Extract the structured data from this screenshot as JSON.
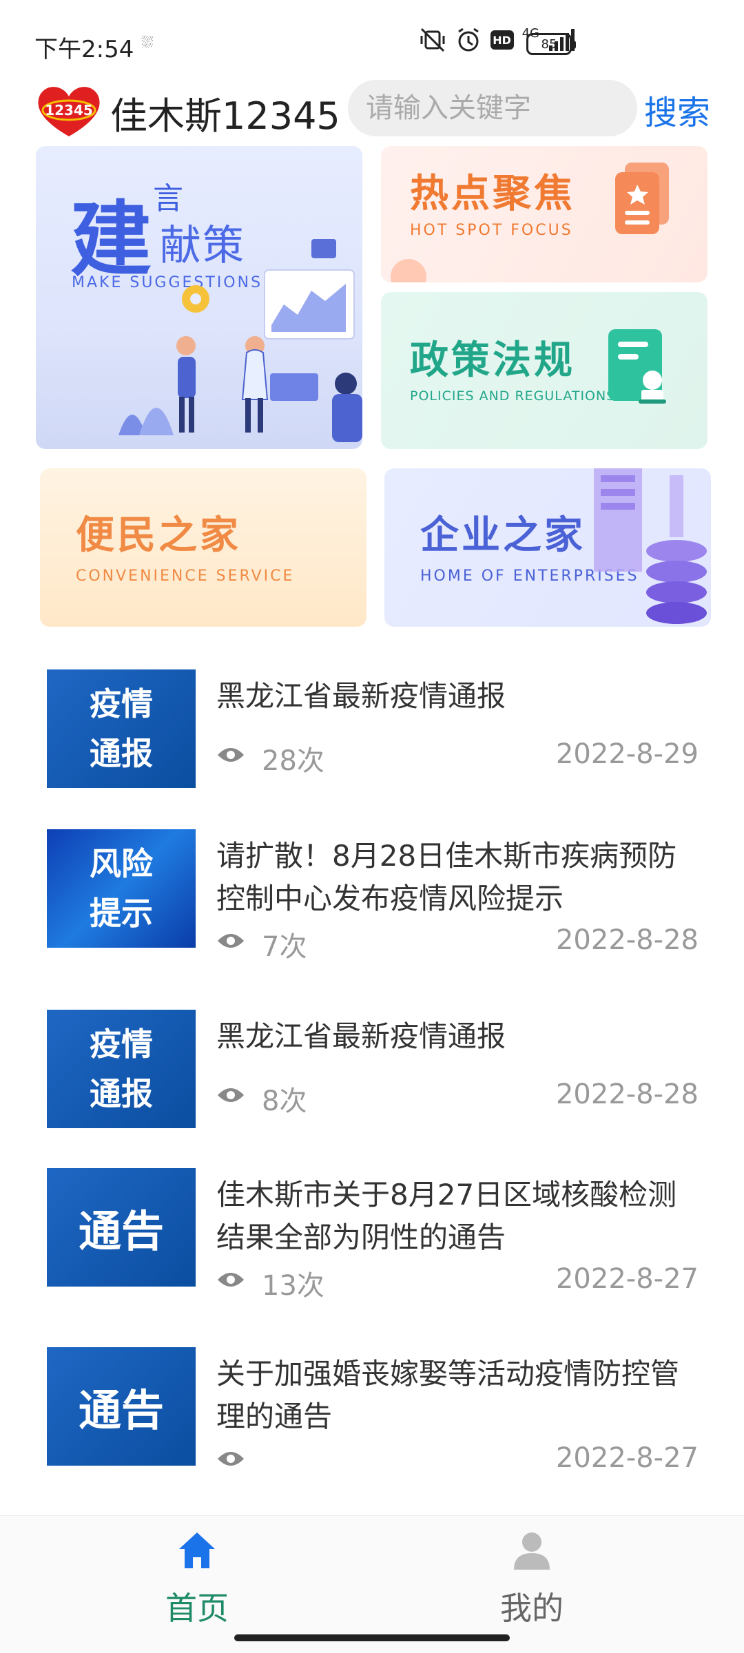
{
  "status_bar": {
    "time": "下午2:54",
    "network": "4G",
    "hd": "HD",
    "battery": "85"
  },
  "header": {
    "app_title": "佳木斯12345",
    "logo_text": "12345",
    "search_placeholder": "请输入关键字",
    "search_label": "搜索"
  },
  "banners": {
    "suggestions": {
      "char1": "建",
      "char2": "言",
      "rest": "献策",
      "sub": "MAKE SUGGESTIONS"
    },
    "hotspot": {
      "title": "热点聚焦",
      "sub": "HOT SPOT FOCUS"
    },
    "policies": {
      "title": "政策法规",
      "sub": "POLICIES AND REGULATIONS"
    },
    "convenience": {
      "title": "便民之家",
      "sub": "CONVENIENCE SERVICE"
    },
    "enterprises": {
      "title": "企业之家",
      "sub": "HOME OF ENTERPRISES"
    }
  },
  "news": [
    {
      "thumb": "疫情\n通报",
      "title": "黑龙江省最新疫情通报",
      "views": "28次",
      "date": "2022-8-29"
    },
    {
      "thumb": "风险\n提示",
      "title": "请扩散！8月28日佳木斯市疾病预防控制中心发布疫情风险提示",
      "views": "7次",
      "date": "2022-8-28"
    },
    {
      "thumb": "疫情\n通报",
      "title": "黑龙江省最新疫情通报",
      "views": "8次",
      "date": "2022-8-28"
    },
    {
      "thumb": "通告",
      "title": "佳木斯市关于8月27日区域核酸检测结果全部为阴性的通告",
      "views": "13次",
      "date": "2022-8-27"
    },
    {
      "thumb": "通告",
      "title": "关于加强婚丧嫁娶等活动疫情防控管理的通告",
      "views": "",
      "date": "2022-8-27"
    }
  ],
  "bottom_nav": {
    "home": "首页",
    "mine": "我的",
    "active": "home",
    "active_color": "#1f8a68"
  },
  "colors": {
    "accent": "#1a73e8",
    "thumb_blue": "#0a4ea0"
  }
}
